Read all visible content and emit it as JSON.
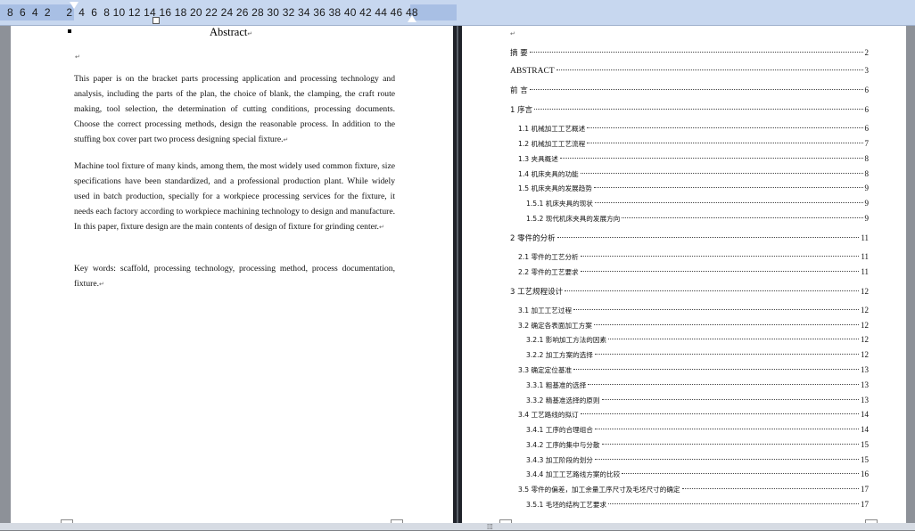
{
  "ruler": {
    "scale": "8  6  4  2     2  4  6  8 10 12 14 16 18 20 22 24 26 28 30 32 34 36 38 40 42 44 46 48"
  },
  "left_page": {
    "title": "Abstract",
    "paragraph_mark": "↵",
    "paragraphs": [
      "This paper is on the bracket parts processing application and processing technology and analysis, including the parts of the plan, the choice of blank, the clamping, the craft route making, tool selection, the determination of cutting conditions, processing documents. Choose the correct processing methods, design the reasonable process. In addition to the stuffing box cover part two process designing special fixture.",
      "Machine tool fixture of many kinds, among them, the most widely used common fixture, size specifications have been standardized, and a professional production plant. While widely used in batch production, specially for a workpiece processing services for the fixture, it needs each factory according to workpiece machining technology to design and manufacture. In this paper, fixture design are the main contents of design of fixture for grinding center.",
      "Key words: scaffold, processing technology, processing method, process documentation, fixture."
    ]
  },
  "toc": [
    {
      "label": "摘    要",
      "page": "2"
    },
    {
      "label": "ABSTRACT",
      "page": "3"
    },
    {
      "label": "前    言",
      "page": "6"
    },
    {
      "label": "1    序言",
      "page": "6"
    },
    {
      "label": "1.1 机械加工工艺概述",
      "page": "6"
    },
    {
      "label": "1.2 机械加工工艺流程",
      "page": "7"
    },
    {
      "label": "1.3 夹具概述",
      "page": "8"
    },
    {
      "label": "1.4 机床夹具的功能",
      "page": "8"
    },
    {
      "label": "1.5 机床夹具的发展趋势",
      "page": "9"
    },
    {
      "label": "1.5.1 机床夹具的现状",
      "page": "9"
    },
    {
      "label": "1.5.2 现代机床夹具的发展方向",
      "page": "9"
    },
    {
      "label": "2    零件的分析",
      "page": "11"
    },
    {
      "label": "2.1 零件的工艺分析",
      "page": "11"
    },
    {
      "label": "2.2 零件的工艺要求",
      "page": "11"
    },
    {
      "label": "3    工艺规程设计",
      "page": "12"
    },
    {
      "label": "3.1 加工工艺过程",
      "page": "12"
    },
    {
      "label": "3.2 确定各表面加工方案",
      "page": "12"
    },
    {
      "label": "3.2.1 影响加工方法的因素",
      "page": "12"
    },
    {
      "label": "3.2.2 加工方案的选择",
      "page": "12"
    },
    {
      "label": "3.3 确定定位基准",
      "page": "13"
    },
    {
      "label": "3.3.1 粗基准的选择",
      "page": "13"
    },
    {
      "label": "3.3.2 精基准选择的原则",
      "page": "13"
    },
    {
      "label": "3.4 工艺路线的拟订",
      "page": "14"
    },
    {
      "label": "3.4.1 工序的合理组合",
      "page": "14"
    },
    {
      "label": "3.4.2 工序的集中与分散",
      "page": "15"
    },
    {
      "label": "3.4.3 加工阶段的划分",
      "page": "15"
    },
    {
      "label": "3.4.4 加工工艺路线方案的比较",
      "page": "16"
    },
    {
      "label": "3.5 零件的偏差，加工余量工序尺寸及毛坯尺寸的确定",
      "page": "17"
    },
    {
      "label": "3.5.1 毛坯的结构工艺要求",
      "page": "17"
    }
  ],
  "statusbar": {
    "handle": "⁞⁞⁞"
  }
}
